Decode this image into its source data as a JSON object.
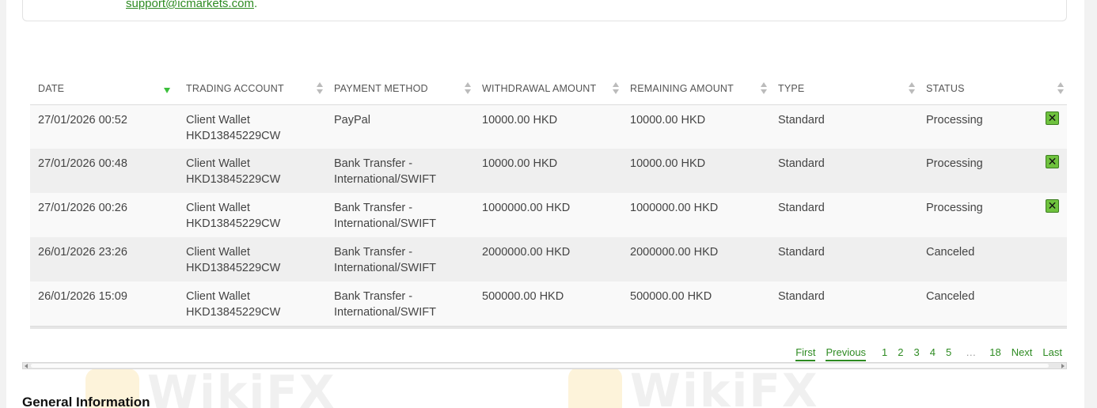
{
  "support": {
    "email": "support@icmarkets.com",
    "suffix": "."
  },
  "watermark": {
    "text": "WikiFX"
  },
  "table": {
    "columns": [
      "DATE",
      "TRADING ACCOUNT",
      "PAYMENT METHOD",
      "WITHDRAWAL AMOUNT",
      "REMAINING AMOUNT",
      "TYPE",
      "STATUS"
    ],
    "rows": [
      {
        "date": "27/01/2026 00:52",
        "account_1": "Client Wallet",
        "account_2": "HKD13845229CW",
        "method_1": "PayPal",
        "method_2": "",
        "withdrawal": "10000.00 HKD",
        "remaining": "10000.00 HKD",
        "type": "Standard",
        "status": "Processing",
        "cancel": "✕"
      },
      {
        "date": "27/01/2026 00:48",
        "account_1": "Client Wallet",
        "account_2": "HKD13845229CW",
        "method_1": "Bank Transfer -",
        "method_2": "International/SWIFT",
        "withdrawal": "10000.00 HKD",
        "remaining": "10000.00 HKD",
        "type": "Standard",
        "status": "Processing",
        "cancel": "✕"
      },
      {
        "date": "27/01/2026 00:26",
        "account_1": "Client Wallet",
        "account_2": "HKD13845229CW",
        "method_1": "Bank Transfer -",
        "method_2": "International/SWIFT",
        "withdrawal": "1000000.00 HKD",
        "remaining": "1000000.00 HKD",
        "type": "Standard",
        "status": "Processing",
        "cancel": "✕"
      },
      {
        "date": "26/01/2026 23:26",
        "account_1": "Client Wallet",
        "account_2": "HKD13845229CW",
        "method_1": "Bank Transfer -",
        "method_2": "International/SWIFT",
        "withdrawal": "2000000.00 HKD",
        "remaining": "2000000.00 HKD",
        "type": "Standard",
        "status": "Canceled"
      },
      {
        "date": "26/01/2026 15:09",
        "account_1": "Client Wallet",
        "account_2": "HKD13845229CW",
        "method_1": "Bank Transfer -",
        "method_2": "International/SWIFT",
        "withdrawal": "500000.00 HKD",
        "remaining": "500000.00 HKD",
        "type": "Standard",
        "status": "Canceled"
      }
    ]
  },
  "pagination": {
    "first": "First",
    "previous": "Previous",
    "pages": [
      "1",
      "2",
      "3",
      "4",
      "5"
    ],
    "ellipsis": "…",
    "last_page": "18",
    "next": "Next",
    "last": "Last"
  },
  "section": {
    "title": "General Information"
  },
  "colors": {
    "accent": "#2e8b22",
    "cancel_button": "#6fc23e",
    "sort_active": "#3bbf3b"
  }
}
